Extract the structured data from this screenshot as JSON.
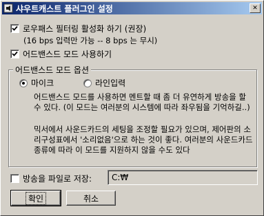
{
  "window": {
    "title": "샤우트캐스트 플러그인 설정",
    "close_glyph": "✕"
  },
  "options": {
    "lowpass_label": "로우패스 필터링 활성화 하기 (권장)",
    "lowpass_checked": true,
    "lowpass_note": "(16 bps 입력만 가능 -- 8 bps 는 무시)",
    "advanced_label": "어드밴스드 모드 사용하기",
    "advanced_checked": true
  },
  "advanced_group": {
    "legend": "어드밴스드 모드 옵션",
    "radio_mic_label": "마이크",
    "radio_line_label": "라인입력",
    "selected": "mic",
    "desc_para1": "어드밴스드 모드를 사용하면 멘트할 때 좀 더 유연하게 방송을 할 수 있다. (이 모드는 여러분의 시스템에 따라 좌우됨을 기억하길..)",
    "desc_para2": "믹서에서 사운드카드의 세팅을 조정할 필요가 있으며, 제어판의 소리구성표에서 '소리없음'으로 하는 것이 좋다. 여러분의 사운드카드 종류에 따라 이 모드를 지원하지 않을 수도 있다"
  },
  "save": {
    "label": "방송을 파일로 저장:",
    "checked": false,
    "path_value": "C:₩"
  },
  "buttons": {
    "ok_label": "확인",
    "cancel_label": "취소"
  },
  "colors": {
    "titlebar_start": "#0a246a",
    "titlebar_end": "#a6caf0",
    "face": "#d4d0c8"
  },
  "icons": {
    "title_icon": "shoutcast-icon",
    "check": "checkmark-icon",
    "close": "close-icon"
  }
}
